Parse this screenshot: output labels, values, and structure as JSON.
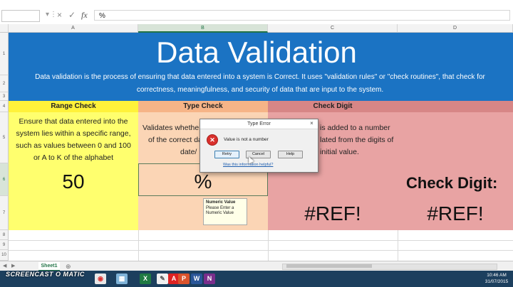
{
  "formula_bar": {
    "cancel_icon": "×",
    "enter_icon": "✓",
    "fx_label": "fx",
    "value": "%"
  },
  "columns": [
    "A",
    "B",
    "C",
    "D"
  ],
  "rows": [
    "1",
    "2",
    "3",
    "4",
    "5",
    "6",
    "7",
    "8",
    "9",
    "10"
  ],
  "banner": {
    "title": "Data Validation",
    "description": "Data validation is the process of ensuring that data entered into a system is Correct. It uses \"validation rules\" or \"check routines\", that check for correctness, meaningfulness, and security of data that are input to the system.",
    "color": "#1b73c3"
  },
  "range_check": {
    "title": "Range Check",
    "description": "Ensure that data entered into the system lies within a specific range, such as values between 0 and 100 or A to K of the alphabet",
    "value": "50",
    "color": "#ffff6e"
  },
  "type_check": {
    "title": "Type Check",
    "description_visible_1": "Validates whethe",
    "description_visible_2": "of the correct dat",
    "description_visible_3": "date/",
    "value": "%",
    "color": "#fbd5b5"
  },
  "check_digit": {
    "title": "Check Digit",
    "description_visible_1": "is added to a number",
    "description_visible_2": "lated from the digits of",
    "description_visible_3": "initial value.",
    "label": "Check Digit:",
    "value_c": "#REF!",
    "value_d": "#REF!",
    "color": "#e8a3a3"
  },
  "input_message": {
    "title": "Numeric Value",
    "body": "Please Enter a Numeric Value"
  },
  "dialog": {
    "title": "Type Error",
    "close": "×",
    "message": "Value is not a number",
    "buttons": [
      "Retry",
      "Cancel",
      "Help"
    ],
    "link": "Was this information helpful?"
  },
  "sheet_tabs": [
    "Sheet1"
  ],
  "watermark": "SCREENCAST O MATIC",
  "taskbar": {
    "icons": [
      "ie-icon",
      "folder-icon",
      "chrome-icon",
      "explorer-icon",
      "excel-icon",
      "paint-icon",
      "acrobat-icon",
      "powerpoint-icon",
      "word-icon",
      "onenote-icon"
    ],
    "time": "10:46 AM",
    "date": "31/07/2015"
  }
}
